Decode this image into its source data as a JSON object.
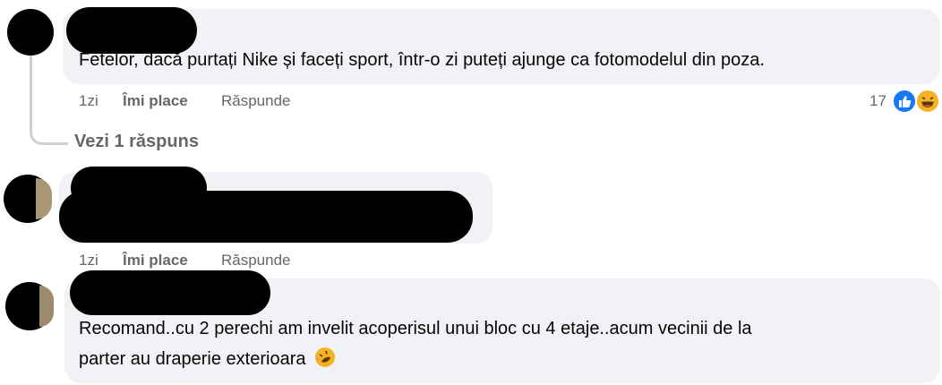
{
  "comments": [
    {
      "text": "Fetelor, dacă purtați Nike și faceți sport, într-o zi puteți ajunge ca fotomodelul din poza.",
      "time": "1zi",
      "like_label": "Îmi place",
      "reply_label": "Răspunde",
      "reaction_count": "17",
      "reactions": [
        "like-icon",
        "haha-icon"
      ],
      "view_replies": "Vezi 1 răspuns"
    },
    {
      "text": "",
      "time": "1zi",
      "like_label": "Îmi place",
      "reply_label": "Răspunde"
    },
    {
      "text_line1": "Recomand..cu 2 perechi am invelit acoperisul unui bloc cu 4 etaje..acum vecinii de la",
      "text_line2": "parter au draperie exterioara",
      "emoji": "rolling-on-floor-laughing-emoji"
    }
  ],
  "colors": {
    "bubble": "#f0f2f5",
    "meta_text": "#65676b",
    "like_blue": "#1877f2",
    "haha_yellow": "#f7b125"
  }
}
